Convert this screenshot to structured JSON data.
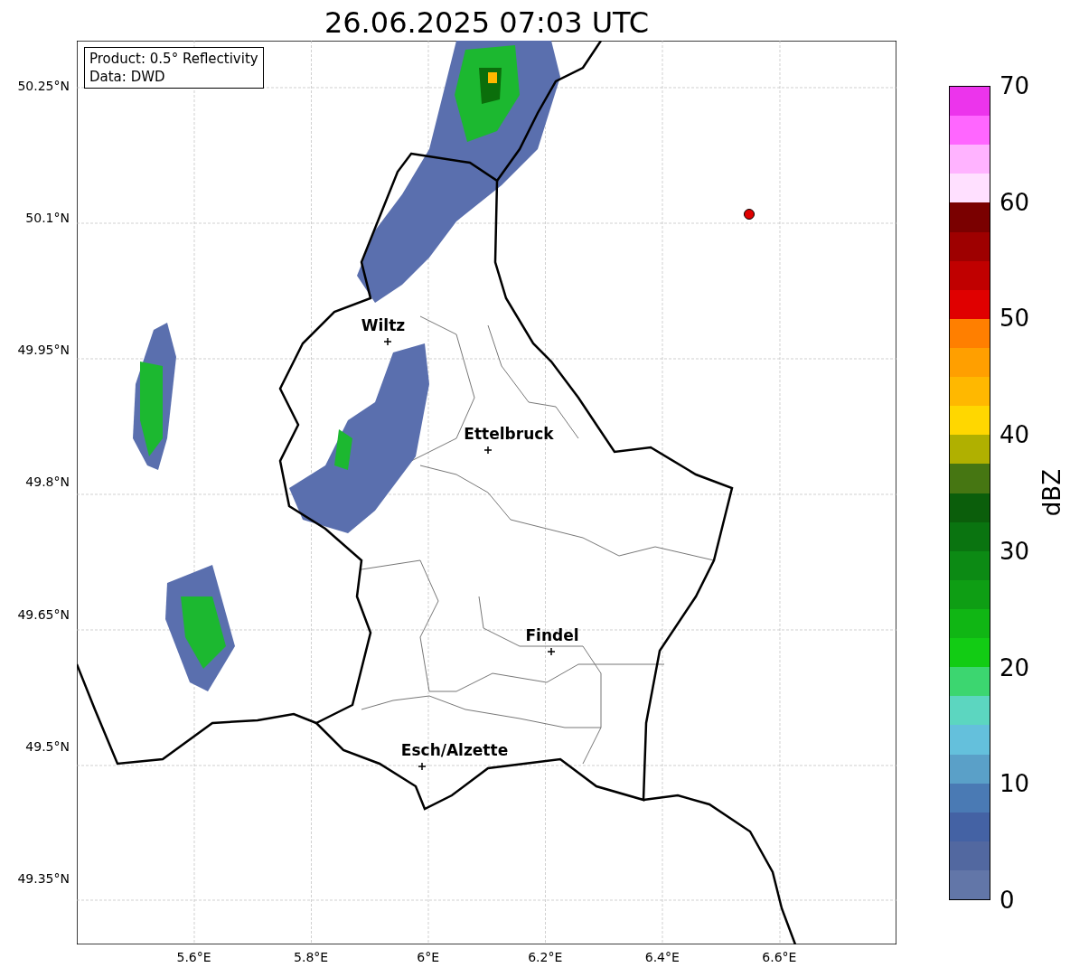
{
  "title": "26.06.2025 07:03 UTC",
  "map": {
    "info": [
      "Product: 0.5° Reflectivity",
      "Data: DWD"
    ],
    "places": [
      {
        "name": "Wiltz"
      },
      {
        "name": "Ettelbruck"
      },
      {
        "name": "Findel"
      },
      {
        "name": "Esch/Alzette"
      }
    ],
    "xticks": [
      "5.6°E",
      "5.8°E",
      "6°E",
      "6.2°E",
      "6.4°E",
      "6.6°E"
    ],
    "yticks": [
      "50.25°N",
      "50.1°N",
      "49.95°N",
      "49.8°N",
      "49.65°N",
      "49.5°N",
      "49.35°N"
    ]
  },
  "colorbar": {
    "label": "dBZ",
    "ticks": [
      "70",
      "60",
      "50",
      "40",
      "30",
      "20",
      "10",
      "0"
    ],
    "segments": [
      {
        "color": "#ec34ec"
      },
      {
        "color": "#ff66ff"
      },
      {
        "color": "#ffb3ff"
      },
      {
        "color": "#ffe0ff"
      },
      {
        "color": "#7a0000"
      },
      {
        "color": "#9e0000"
      },
      {
        "color": "#c00000"
      },
      {
        "color": "#e00000"
      },
      {
        "color": "#ff7f00"
      },
      {
        "color": "#ff9f00"
      },
      {
        "color": "#ffb800"
      },
      {
        "color": "#ffd700"
      },
      {
        "color": "#b0b000"
      },
      {
        "color": "#467612"
      },
      {
        "color": "#0b5e0b"
      },
      {
        "color": "#0a7410"
      },
      {
        "color": "#0c8a14"
      },
      {
        "color": "#0e9e14"
      },
      {
        "color": "#10b614"
      },
      {
        "color": "#12cc14"
      },
      {
        "color": "#3cd670"
      },
      {
        "color": "#5cd6c0"
      },
      {
        "color": "#64c0dc"
      },
      {
        "color": "#5aa0c8"
      },
      {
        "color": "#4a7ab4"
      },
      {
        "color": "#4462a4"
      },
      {
        "color": "#5268a0"
      },
      {
        "color": "#6276a8"
      }
    ]
  }
}
